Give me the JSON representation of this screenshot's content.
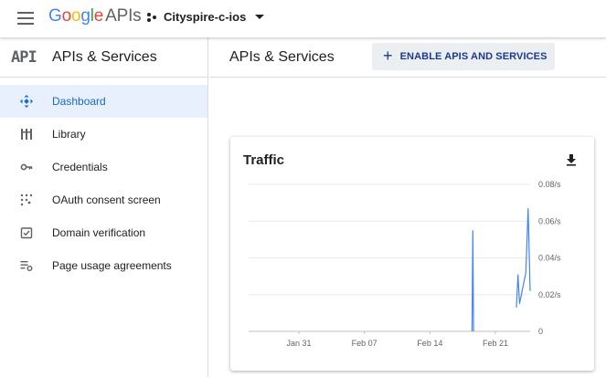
{
  "topbar": {
    "brand_letters": [
      "G",
      "o",
      "o",
      "g",
      "l",
      "e"
    ],
    "brand_suffix": "APIs",
    "project_name": "Cityspire-c-ios"
  },
  "sidebar": {
    "logo_text": "API",
    "title": "APIs & Services",
    "items": [
      {
        "label": "Dashboard",
        "icon": "dashboard-icon",
        "active": true
      },
      {
        "label": "Library",
        "icon": "library-icon",
        "active": false
      },
      {
        "label": "Credentials",
        "icon": "key-icon",
        "active": false
      },
      {
        "label": "OAuth consent screen",
        "icon": "oauth-icon",
        "active": false
      },
      {
        "label": "Domain verification",
        "icon": "checkbox-icon",
        "active": false
      },
      {
        "label": "Page usage agreements",
        "icon": "settings-list-icon",
        "active": false
      }
    ]
  },
  "main": {
    "title": "APIs & Services",
    "enable_button": "ENABLE APIS AND SERVICES"
  },
  "colors": {
    "accent": "#1967d2",
    "active_bg": "#e8f0fe",
    "line": "#4285f4",
    "button_bg": "#eceff1"
  },
  "chart_data": {
    "type": "line",
    "title": "Traffic",
    "y_ticks": [
      "0.08/s",
      "0.06/s",
      "0.04/s",
      "0.02/s",
      "0"
    ],
    "x_ticks": [
      "Jan 31",
      "Feb 07",
      "Feb 14",
      "Feb 21"
    ],
    "ylim": [
      0,
      0.08
    ],
    "series": [
      {
        "points": [
          {
            "x": "Feb 18 12:00",
            "y": 0
          },
          {
            "x": "Feb 18 14:00",
            "y": 0.055
          },
          {
            "x": "Feb 18 16:00",
            "y": 0
          }
        ]
      },
      {
        "points": [
          {
            "x": "Feb 23 06:00",
            "y": 0.013
          },
          {
            "x": "Feb 23 10:00",
            "y": 0.031
          },
          {
            "x": "Feb 23 14:00",
            "y": 0.015
          },
          {
            "x": "Feb 24 06:00",
            "y": 0.032
          },
          {
            "x": "Feb 24 12:00",
            "y": 0.067
          },
          {
            "x": "Feb 24 18:00",
            "y": 0.022
          }
        ]
      }
    ]
  }
}
